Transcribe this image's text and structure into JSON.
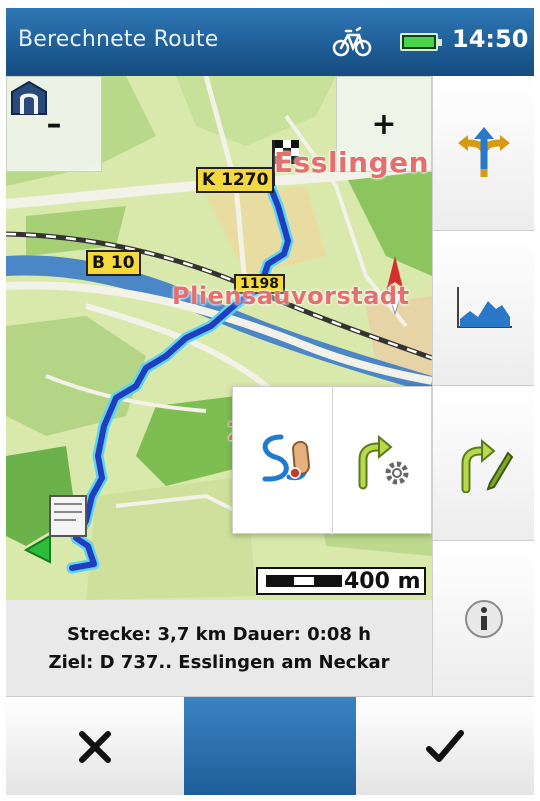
{
  "statusbar": {
    "title": "Berechnete Route",
    "time": "14:50",
    "bike_icon": "bicycle-icon",
    "battery_icon": "battery-icon",
    "battery_level": 1.0
  },
  "map": {
    "zoom_out_label": "–",
    "zoom_in_label": "+",
    "road_labels": [
      "K 1270",
      "B 10",
      "1198"
    ],
    "place_labels": [
      "Esslingen",
      "Pliensauvorstadt",
      "Z"
    ],
    "scale_label": "400 m",
    "colors": {
      "route": "#1f3fbf",
      "route_glow": "#5fd4f2",
      "water": "#4b86c7",
      "road": "#f2f2e8",
      "forest": "#6cb24a"
    }
  },
  "popup": {
    "option_icons": [
      "freehand-route-icon",
      "route-settings-icon"
    ]
  },
  "sidebar": {
    "icons": [
      "route-alternatives-icon",
      "elevation-profile-icon",
      "edit-route-icon",
      "info-icon"
    ]
  },
  "info": {
    "distance_line": "Strecke: 3,7 km Dauer: 0:08 h",
    "destination_line": "Ziel: D 737.. Esslingen am Neckar"
  },
  "bottombar": {
    "cancel_icon": "close-icon",
    "confirm_icon": "check-icon"
  }
}
